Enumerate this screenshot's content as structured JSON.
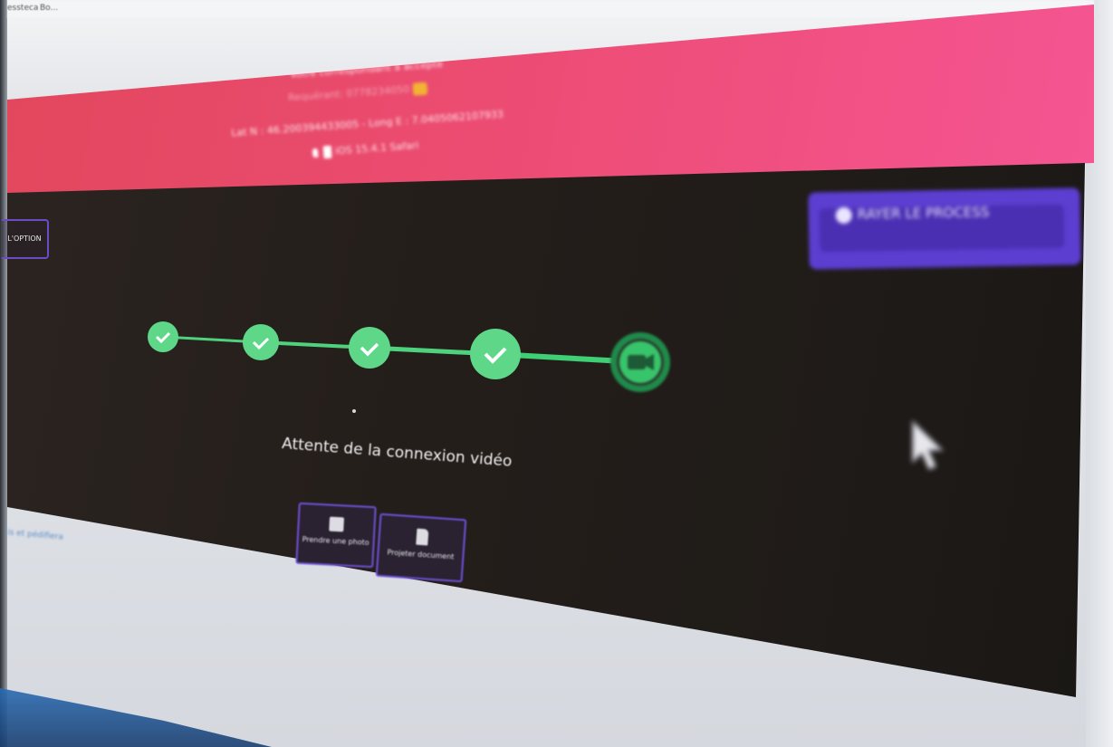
{
  "browser": {
    "tab_left": "essteca",
    "tab_right": "Bo..."
  },
  "banner": {
    "line1": "Votre correspondant a accepté",
    "line2": "Requérant: 0778234050",
    "line3": "Lat N : 46.200394433005 - Long E : 7.0405062107933",
    "line4": "iOS 15.4.1 Safari"
  },
  "option_button": {
    "label": "L'OPTION"
  },
  "top_right_button": {
    "label": "RAYER LE PROCESS"
  },
  "stepper": {
    "steps_total": 5,
    "steps_completed": 4,
    "current_step_icon": "video-camera-icon",
    "active_color": "#3fcf74",
    "completed_color": "#5ed888"
  },
  "status": {
    "text": "Attente de la connexion vidéo"
  },
  "actions": {
    "photo_label": "Prendre une photo",
    "document_label": "Projeter document"
  },
  "left_link": {
    "text": "is et pédifiera"
  },
  "colors": {
    "banner_start": "#e2475d",
    "banner_end": "#f55592",
    "panel": "#241e1a",
    "button_purple": "#5c3ed0",
    "button_border": "#6f4fd8"
  }
}
